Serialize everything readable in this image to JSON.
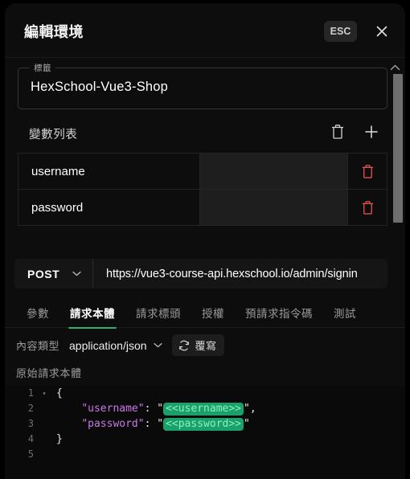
{
  "header": {
    "title": "編輯環境",
    "esc_label": "ESC",
    "close_icon": "close-icon"
  },
  "environment": {
    "label_legend": "標籤",
    "label_value": "HexSchool-Vue3-Shop",
    "varlist_title": "變數列表",
    "delete_all_icon": "trash-icon",
    "add_icon": "plus-icon",
    "variables": [
      {
        "name": "username",
        "value": ""
      },
      {
        "name": "password",
        "value": ""
      }
    ],
    "row_delete_icon": "trash-icon"
  },
  "scroll": {
    "up_icon": "chevron-up-icon"
  },
  "request": {
    "method": "POST",
    "method_caret_icon": "chevron-down-icon",
    "url": "https://vue3-course-api.hexschool.io/admin/signin",
    "tabs": [
      {
        "label": "參數",
        "active": false
      },
      {
        "label": "請求本體",
        "active": true
      },
      {
        "label": "請求標頭",
        "active": false
      },
      {
        "label": "授權",
        "active": false
      },
      {
        "label": "預請求指令碼",
        "active": false
      },
      {
        "label": "測試",
        "active": false
      }
    ],
    "active_tab_color": "#2eae73",
    "content_type_label": "內容類型",
    "content_type_value": "application/json",
    "content_type_caret_icon": "chevron-down-icon",
    "overwrite_icon": "refresh-icon",
    "overwrite_label": "覆寫",
    "raw_body_label": "原始請求本體"
  },
  "editor": {
    "fold_marker": "▾",
    "lines": [
      {
        "num": "1",
        "fold": true,
        "segments": [
          {
            "type": "punc",
            "text": "{"
          }
        ]
      },
      {
        "num": "2",
        "fold": false,
        "segments": [
          {
            "type": "plain",
            "text": "    "
          },
          {
            "type": "key",
            "text": "\"username\""
          },
          {
            "type": "punc",
            "text": ": "
          },
          {
            "type": "quote",
            "text": "\""
          },
          {
            "type": "chip",
            "text": "<<username>>"
          },
          {
            "type": "quote",
            "text": "\""
          },
          {
            "type": "punc",
            "text": ","
          }
        ]
      },
      {
        "num": "3",
        "fold": false,
        "segments": [
          {
            "type": "plain",
            "text": "    "
          },
          {
            "type": "key",
            "text": "\"password\""
          },
          {
            "type": "punc",
            "text": ": "
          },
          {
            "type": "quote",
            "text": "\""
          },
          {
            "type": "chip",
            "text": "<<password>>"
          },
          {
            "type": "quote",
            "text": "\""
          }
        ]
      },
      {
        "num": "4",
        "fold": false,
        "segments": [
          {
            "type": "punc",
            "text": "}"
          }
        ]
      },
      {
        "num": "5",
        "fold": false,
        "segments": []
      }
    ],
    "chip_bg": "#1aa06a",
    "chip_fg": "#8af0c0",
    "key_color": "#c779e8"
  }
}
